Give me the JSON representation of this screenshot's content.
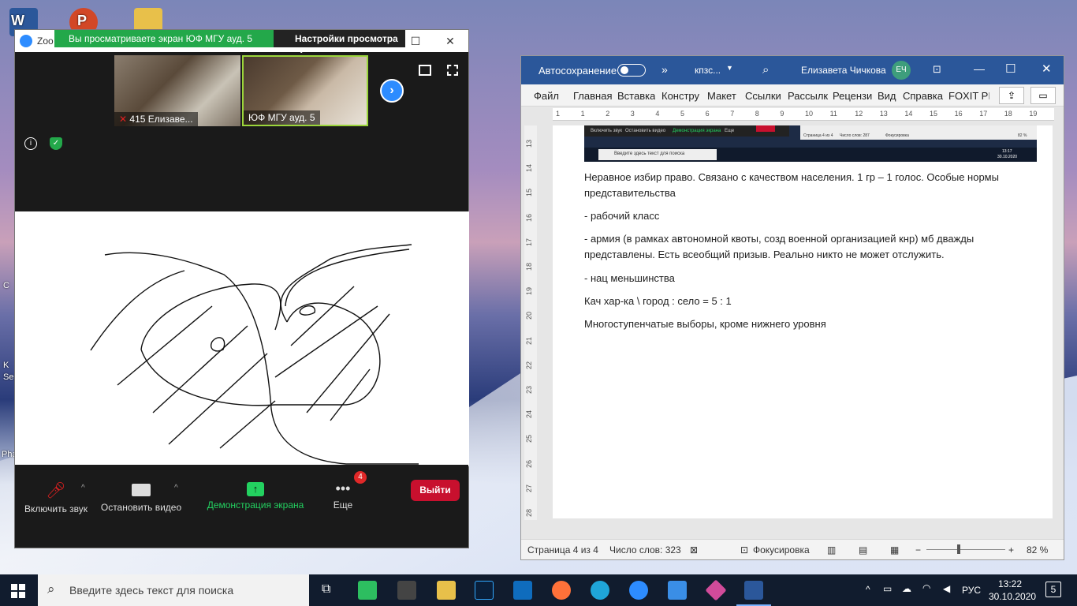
{
  "desktop": {
    "icon_labels": [
      "W",
      "P",
      "C",
      "K",
      "Se",
      "Pha"
    ]
  },
  "zoom": {
    "title": "Zoo",
    "banner_text": "Вы просматриваете экран ЮФ МГУ ауд. 5",
    "view_settings": "Настройки просмотра",
    "participants": [
      {
        "name": "415 Елизаве..."
      },
      {
        "name": "ЮФ МГУ ауд. 5"
      }
    ],
    "toolbar": {
      "mute": "Включить звук",
      "video": "Остановить видео",
      "share": "Демонстрация экрана",
      "more": "Еще",
      "more_badge": "4",
      "leave": "Выйти"
    },
    "colors": {
      "share_green": "#23a84a",
      "leave_red": "#c8102e"
    }
  },
  "word": {
    "autosave": "Автосохранение",
    "doc_name": "кпзс...",
    "user": "Елизавета Чичкова",
    "user_initials": "ЕЧ",
    "ribbon_tabs": [
      "Файл",
      "Главная",
      "Вставка",
      "Констру",
      "Макет",
      "Ссылки",
      "Рассылк",
      "Рецензи",
      "Вид",
      "Справка",
      "FOXIT PI"
    ],
    "ruler_marks": [
      "1",
      "1",
      "2",
      "3",
      "4",
      "5",
      "6",
      "7",
      "8",
      "9",
      "10",
      "11",
      "12",
      "13",
      "14",
      "15",
      "16",
      "17",
      "18",
      "19"
    ],
    "vruler_marks": [
      "13",
      "14",
      "15",
      "16",
      "17",
      "18",
      "19",
      "20",
      "21",
      "22",
      "23",
      "24",
      "25",
      "26",
      "27",
      "28"
    ],
    "embedded": {
      "mute": "Включить звук",
      "video": "Остановить видео",
      "share": "Демонстрация экрана",
      "more": "Еще",
      "search": "Введите здесь текст для поиска",
      "status_page": "Страница 4 из 4",
      "status_words": "Число слов: 287",
      "focus": "Фокусировка",
      "zoom": "82 %",
      "time": "13:17",
      "date": "30.10.2020"
    },
    "paragraphs": [
      "Неравное избир право. Связано с качеством населения. 1 гр – 1 голос. Особые нормы представительства",
      "- рабочий класс",
      "- армия (в рамках автономной квоты, созд военной организацией кнр) мб дважды представлены. Есть всеобщий призыв. Реально никто не может отслужить.",
      "- нац меньшинства",
      "Кач хар-ка \\ город : село = 5 : 1",
      "Многоступенчатые выборы, кроме нижнего уровня"
    ],
    "status": {
      "page": "Страница 4 из 4",
      "words": "Число слов: 323",
      "focus": "Фокусировка",
      "zoom": "82 %"
    }
  },
  "taskbar": {
    "search_placeholder": "Введите здесь текст для поиска",
    "lang": "РУС",
    "time": "13:22",
    "date": "30.10.2020",
    "notifications": "5"
  }
}
